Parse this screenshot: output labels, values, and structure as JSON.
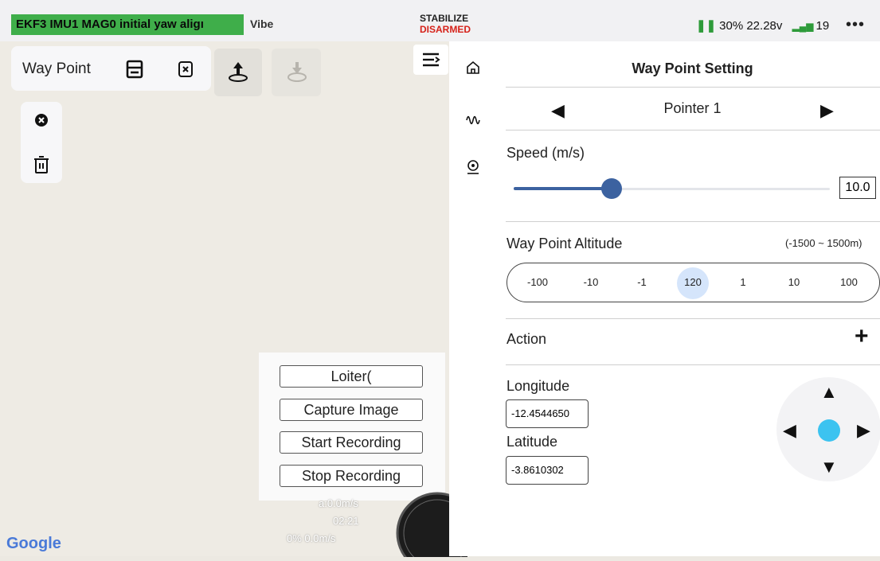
{
  "status": {
    "message": "EKF3 IMU1 MAG0 initial yaw aligı",
    "vehicle": "Vibe",
    "mode": "STABILIZE",
    "arm_state": "DISARMED",
    "battery_percent": "30%",
    "voltage": "22.28v",
    "satellites": "19",
    "more": "•••"
  },
  "map": {
    "toolbar_title": "Way Point",
    "actions": [
      "Loiter(",
      "Capture Image",
      "Start Recording",
      "Stop Recording"
    ],
    "hud_speed1": "a:0.0m/s",
    "hud_time": "02:21",
    "hud_bottom": "0%",
    "hud_speed2": "0.0m/s",
    "attribution": "Google"
  },
  "panel": {
    "title": "Way Point Setting",
    "pointer": "Pointer 1",
    "speed_label": "Speed (m/s)",
    "speed_value": "10.0",
    "speed_fraction": 0.31,
    "altitude_label": "Way Point Altitude",
    "altitude_range": "(-1500 ~ 1500m)",
    "altitude_options": [
      "-100",
      "-10",
      "-1",
      "120",
      "1",
      "10",
      "100"
    ],
    "altitude_selected_index": 3,
    "action_label": "Action",
    "action_add": "+",
    "longitude_label": "Longitude",
    "longitude_value": "-12.4544650",
    "latitude_label": "Latitude",
    "latitude_value": "-3.8610302"
  },
  "colors": {
    "status_green": "#3fae4a",
    "disarmed_red": "#d6221a",
    "slider_blue": "#3c62a0",
    "dpad_center": "#3cc3f0",
    "altitude_selected": "#d5e5fb"
  },
  "icons": [
    "save-icon",
    "close-file-icon",
    "upload-icon",
    "download-icon",
    "cancel-icon",
    "trash-icon",
    "menu-icon",
    "home-icon",
    "waveform-icon",
    "location-icon",
    "left-arrow-icon",
    "right-arrow-icon",
    "up-arrow-icon",
    "down-arrow-icon"
  ]
}
